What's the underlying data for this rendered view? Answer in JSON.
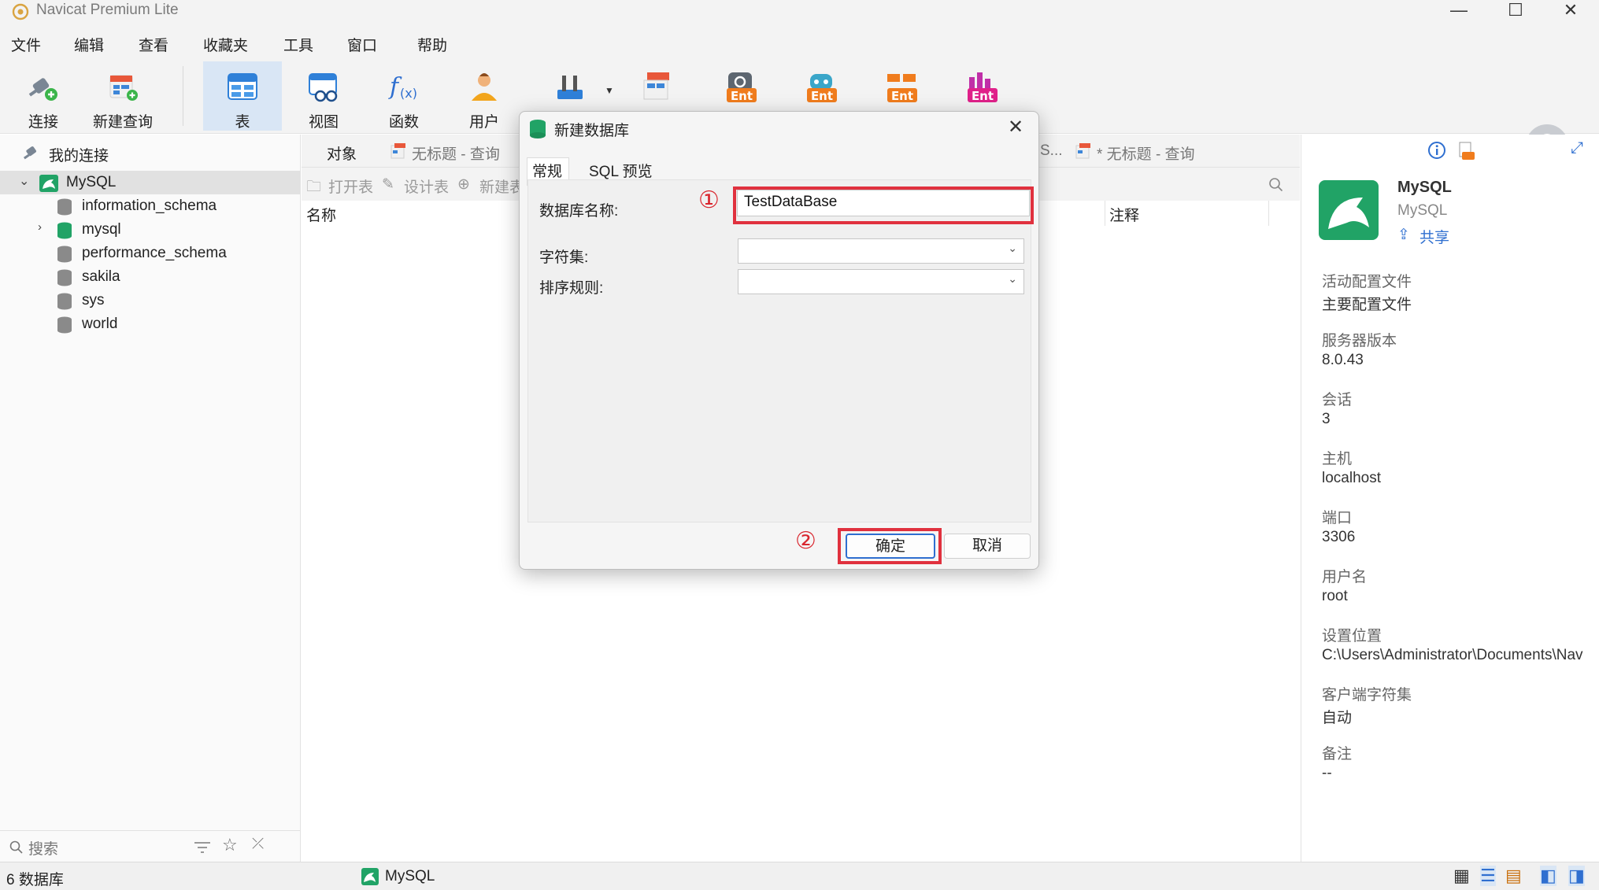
{
  "titlebar": {
    "title": "Navicat Premium Lite",
    "minimize": "—",
    "maximize": "☐",
    "close": "✕"
  },
  "menu": [
    "文件",
    "编辑",
    "查看",
    "收藏夹",
    "工具",
    "窗口",
    "帮助"
  ],
  "toolbar": {
    "connect": "连接",
    "new_query": "新建查询",
    "table": "表",
    "view": "视图",
    "function": "函数",
    "user": "用户",
    "ent_badge": "Ent"
  },
  "left": {
    "my_connections": "我的连接",
    "connection": "MySQL",
    "databases": [
      "information_schema",
      "mysql",
      "performance_schema",
      "sakila",
      "sys",
      "world"
    ],
    "search_placeholder": "搜索"
  },
  "center": {
    "tabs": {
      "objects": "对象",
      "query_tab": "无标题 - 查询",
      "partial_tab": "S...",
      "query_tab_modified": "* 无标题 - 查询"
    },
    "subtoolbar": {
      "open_table": "打开表",
      "design_table": "设计表",
      "new_table": "新建表"
    },
    "columns": {
      "name": "名称",
      "comment": "注释"
    }
  },
  "right": {
    "name": "MySQL",
    "type": "MySQL",
    "share": "共享",
    "fields": [
      {
        "label": "活动配置文件",
        "value": "主要配置文件"
      },
      {
        "label": "服务器版本",
        "value": "8.0.43"
      },
      {
        "label": "会话",
        "value": "3"
      },
      {
        "label": "主机",
        "value": "localhost"
      },
      {
        "label": "端口",
        "value": "3306"
      },
      {
        "label": "用户名",
        "value": "root"
      },
      {
        "label": "设置位置",
        "value": "C:\\Users\\Administrator\\Documents\\Nav"
      },
      {
        "label": "客户端字符集",
        "value": "自动"
      },
      {
        "label": "备注",
        "value": "--"
      }
    ]
  },
  "status": {
    "db_count": "6 数据库",
    "connection": "MySQL"
  },
  "dialog": {
    "title": "新建数据库",
    "tabs": {
      "general": "常规",
      "sql_preview": "SQL 预览"
    },
    "db_name_label": "数据库名称:",
    "db_name_value": "TestDataBase",
    "charset_label": "字符集:",
    "collation_label": "排序规则:",
    "ok": "确定",
    "cancel": "取消",
    "step1": "①",
    "step2": "②"
  },
  "colors": {
    "accent": "#2f6fd0",
    "highlight": "#e0313e",
    "mysql_green": "#21a366"
  }
}
